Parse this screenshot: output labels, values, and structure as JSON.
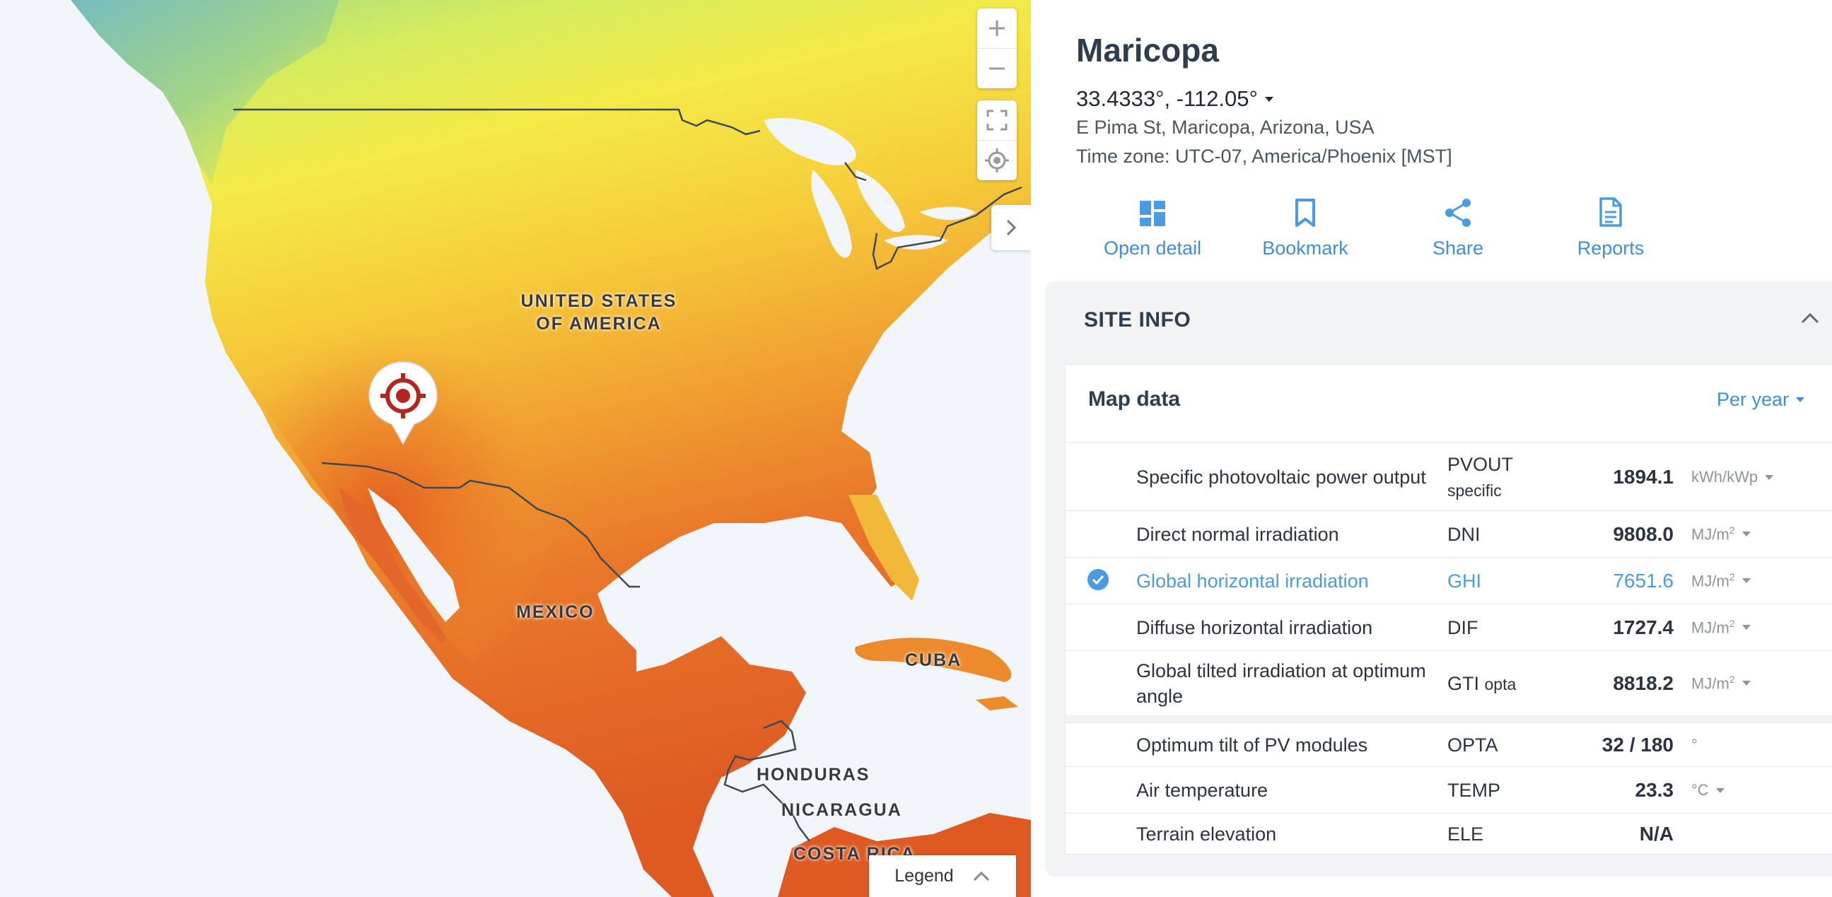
{
  "map": {
    "labels": {
      "usa": "UNITED STATES\nOF AMERICA",
      "mexico": "MEXICO",
      "cuba": "CUBA",
      "honduras": "HONDURAS",
      "nicaragua": "NICARAGUA",
      "costa_rica": "COSTA RICA"
    },
    "controls": {
      "zoom_in_icon": "plus-icon",
      "zoom_out_icon": "minus-icon",
      "fullscreen_icon": "fullscreen-icon",
      "locate_icon": "locate-icon",
      "collapse_icon": "chevron-right-icon"
    },
    "legend": {
      "label": "Legend"
    },
    "marker_icon": "target-marker-icon"
  },
  "site": {
    "title": "Maricopa",
    "coords": "33.4333°, -112.05°",
    "address": "E Pima St, Maricopa, Arizona, USA",
    "timezone": "Time zone: UTC-07, America/Phoenix [MST]"
  },
  "actions": [
    {
      "label": "Open detail",
      "icon": "dashboard-icon"
    },
    {
      "label": "Bookmark",
      "icon": "bookmark-icon"
    },
    {
      "label": "Share",
      "icon": "share-icon"
    },
    {
      "label": "Reports",
      "icon": "document-icon"
    }
  ],
  "site_info": {
    "header": "SITE INFO",
    "card_title": "Map data",
    "period": "Per year",
    "rows": [
      {
        "name": "Specific photovoltaic power output",
        "abbr": "PVOUT",
        "abbr_sub": "specific",
        "value": "1894.1",
        "unit": "kWh/kWp",
        "unit_sup": ""
      },
      {
        "name": "Direct normal irradiation",
        "abbr": "DNI",
        "abbr_sub": "",
        "value": "9808.0",
        "unit": "MJ/m",
        "unit_sup": "2"
      },
      {
        "name": "Global horizontal irradiation",
        "abbr": "GHI",
        "abbr_sub": "",
        "value": "7651.6",
        "unit": "MJ/m",
        "unit_sup": "2",
        "selected": true
      },
      {
        "name": "Diffuse horizontal irradiation",
        "abbr": "DIF",
        "abbr_sub": "",
        "value": "1727.4",
        "unit": "MJ/m",
        "unit_sup": "2"
      },
      {
        "name": "Global tilted irradiation at optimum angle",
        "abbr": "GTI",
        "abbr_sub": "opta",
        "value": "8818.2",
        "unit": "MJ/m",
        "unit_sup": "2"
      },
      {
        "name": "Optimum tilt of PV modules",
        "abbr": "OPTA",
        "abbr_sub": "",
        "value": "32 /  180",
        "unit": "°",
        "unit_sup": ""
      },
      {
        "name": "Air temperature",
        "abbr": "TEMP",
        "abbr_sub": "",
        "value": "23.3",
        "unit": "°C",
        "unit_sup": ""
      },
      {
        "name": "Terrain elevation",
        "abbr": "ELE",
        "abbr_sub": "",
        "value": "N/A",
        "unit": "",
        "unit_sup": ""
      }
    ]
  },
  "colors": {
    "accent": "#3f8fd8",
    "marker": "#b3261e",
    "solar_low": "#a9d98b",
    "solar_mid": "#f3e84a",
    "solar_high": "#e85a1e"
  }
}
